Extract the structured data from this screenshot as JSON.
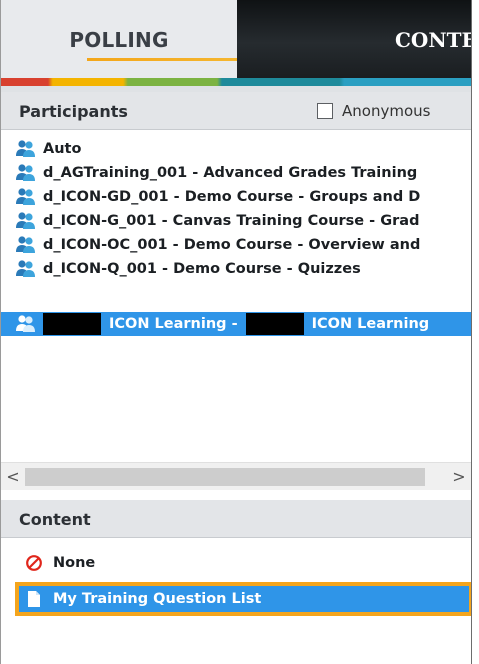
{
  "tabs": {
    "polling": "POLLING",
    "content": "CONTE"
  },
  "participants": {
    "title": "Participants",
    "anonymous_label": "Anonymous",
    "anonymous_checked": false,
    "items": [
      {
        "label": "Auto",
        "selected": false
      },
      {
        "label": "d_AGTraining_001 - Advanced Grades Training",
        "selected": false
      },
      {
        "label": "d_ICON-GD_001 - Demo Course - Groups and D",
        "selected": false
      },
      {
        "label": "d_ICON-G_001 - Canvas Training Course - Grad",
        "selected": false
      },
      {
        "label": "d_ICON-OC_001 - Demo Course - Overview and",
        "selected": false
      },
      {
        "label": "d_ICON-Q_001 - Demo Course - Quizzes",
        "selected": false
      },
      {
        "label_part1": "ICON Learning -",
        "label_part2": "ICON Learning",
        "selected": true
      }
    ]
  },
  "scrollbar": {
    "left_arrow": "<",
    "right_arrow": ">"
  },
  "content": {
    "title": "Content",
    "items": [
      {
        "label": "None",
        "icon": "no-entry-icon",
        "selected": false
      },
      {
        "label": "My Training Question List",
        "icon": "document-icon",
        "selected": true
      }
    ]
  },
  "colors": {
    "selection": "#2f95e8",
    "highlight_outline": "#f4a51d",
    "tab_underline": "#f3a61a"
  }
}
